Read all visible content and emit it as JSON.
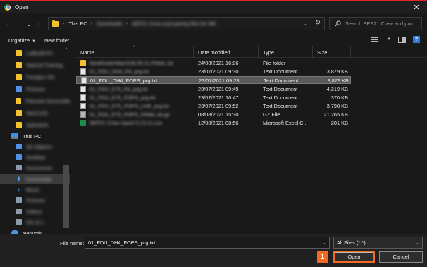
{
  "window": {
    "title": "Open",
    "close_glyph": "✕",
    "accent": "#e0262b"
  },
  "nav": {
    "back_glyph": "←",
    "forward_glyph": "→",
    "history_glyph": "⌄",
    "up_glyph": "↑",
    "breadcrumbs": [
      {
        "label": "This PC",
        "blurred": false
      },
      {
        "label": "Downloads",
        "blurred": true
      },
      {
        "label": "SEP21 Crew and pairing files for NB",
        "blurred": true
      }
    ],
    "separator": "›",
    "refresh_glyph": "↻",
    "search_placeholder": "Search SEP21 Crew and pain..."
  },
  "toolbar": {
    "organize_label": "Organize",
    "new_folder_label": "New folder",
    "dropdown_glyph": "▼"
  },
  "sidebar": {
    "items": [
      {
        "label": "LatBuild R1",
        "icon": "folder",
        "blurred": true
      },
      {
        "label": "Natural Training",
        "icon": "folder",
        "blurred": true
      },
      {
        "label": "Paragon SH",
        "icon": "folder",
        "blurred": true
      },
      {
        "label": "Pictures",
        "icon": "blue",
        "blurred": true
      },
      {
        "label": "Planned Serviceble",
        "icon": "folder",
        "blurred": true
      },
      {
        "label": "Sets1102",
        "icon": "folder",
        "blurred": true
      },
      {
        "label": "SelectOS",
        "icon": "folder",
        "blurred": true
      },
      {
        "label": "This PC",
        "icon": "pc",
        "blurred": false
      },
      {
        "label": "3D Objects",
        "icon": "blue",
        "blurred": true
      },
      {
        "label": "Desktop",
        "icon": "blue",
        "blurred": true
      },
      {
        "label": "Documents",
        "icon": "gray",
        "blurred": true
      },
      {
        "label": "Downloads",
        "icon": "down",
        "blurred": true,
        "selected": true
      },
      {
        "label": "Music",
        "icon": "music",
        "blurred": true
      },
      {
        "label": "Pictures",
        "icon": "gray",
        "blurred": true
      },
      {
        "label": "Videos",
        "icon": "gray",
        "blurred": true
      },
      {
        "label": "OS (C:)",
        "icon": "gray",
        "blurred": true
      },
      {
        "label": "Network",
        "icon": "net",
        "blurred": false
      }
    ]
  },
  "columns": {
    "name": "Name",
    "date": "Date modified",
    "type": "Type",
    "size": "Size",
    "sort_glyph": "^"
  },
  "files": [
    {
      "name": "NewRosterMarch28.05.21.FINAL.txt",
      "blurred": true,
      "date": "24/08/2021 16:06",
      "type": "File folder",
      "size": "",
      "icon": "folder"
    },
    {
      "name": "01_FDU_DH4_FA_prg.txt",
      "blurred": true,
      "date": "23/07/2021 09:30",
      "type": "Text Document",
      "size": "3,879 KB",
      "icon": "doc"
    },
    {
      "name": "01_FDU_DH4_FOPS_prg.txt",
      "blurred": false,
      "date": "23/07/2021 09:23",
      "type": "Text Document",
      "size": "3,879 KB",
      "icon": "doc",
      "selected": true
    },
    {
      "name": "01_FDU_E75_FA_prg.txt",
      "blurred": true,
      "date": "23/07/2021 09:49",
      "type": "Text Document",
      "size": "4,219 KB",
      "icon": "doc"
    },
    {
      "name": "01_FDU_E75_FOPS_prg.txt",
      "blurred": true,
      "date": "23/07/2021 10:47",
      "type": "Text Document",
      "size": "370 KB",
      "icon": "doc"
    },
    {
      "name": "01_FDU_E75_FOPS_LHR_prg.txt",
      "blurred": true,
      "date": "23/07/2021 09:52",
      "type": "Text Document",
      "size": "3,798 KB",
      "icon": "doc"
    },
    {
      "name": "01_FDU_E75_FOPS_FINAL.txt.gz",
      "blurred": true,
      "date": "08/08/2021 15:30",
      "type": "GZ File",
      "size": "21,265 KB",
      "icon": "gz"
    },
    {
      "name": "SEP21 Crew report 0.13.21.csv",
      "blurred": true,
      "date": "12/08/2021 08:56",
      "type": "Microsoft Excel C...",
      "size": "201 KB",
      "icon": "xls"
    }
  ],
  "footer": {
    "filename_label": "File name:",
    "filename_value": "01_FDU_DH4_FOPS_prg.txt",
    "filter_value": "All Files (*.*)",
    "dropdown_glyph": "⌄",
    "open_label": "Open",
    "cancel_label": "Cancel",
    "step_badge": "1",
    "badge_color": "#f06a21"
  }
}
